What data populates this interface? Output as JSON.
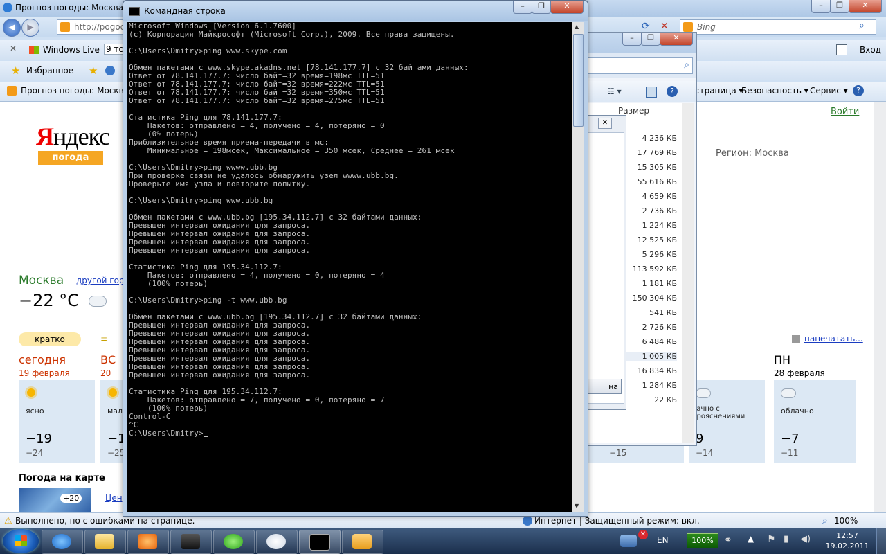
{
  "ie": {
    "title": "Прогноз погоды: Москва (Р",
    "address": "http://pogod",
    "search_placeholder": "Bing",
    "toolbar_items": [
      "Windows Live",
      "9 точ"
    ],
    "login": "Вход",
    "favorites": "Избранное",
    "tab_title": "Прогноз погоды: Москва (Р",
    "command_bar": [
      "страница ▾",
      "Безопасность ▾",
      "Сервис ▾"
    ],
    "status_text": "Выполнено, но с ошибками на странице.",
    "status_zone": "Интернет | Защищенный режим: вкл.",
    "zoom": "100%"
  },
  "yandex": {
    "logo_first": "Я",
    "logo_rest": "ндекс",
    "pogoda": "погода",
    "login_link": "Войти",
    "region_label": "Регион",
    "region_value": ": Москва",
    "city": "Москва",
    "other_city": "другой гор",
    "temp": "−22 °С",
    "short_btn": "кратко",
    "print_link": "напечатать...",
    "map_title": "Погода на карте",
    "map_temp": "+20",
    "map_link": "Цен",
    "days": [
      {
        "name": "сегодня",
        "date": "19 февраля",
        "cond": "ясно",
        "hi": "−19",
        "lo": "−24",
        "icon": "sun-icon"
      },
      {
        "name": "ВС",
        "date": "20",
        "cond": "мал",
        "hi": "−1",
        "lo": "−25",
        "icon": "sun-cloud-icon"
      },
      {
        "name": "",
        "date": "",
        "cond": "",
        "hi": "",
        "lo": "−15",
        "icon": ""
      },
      {
        "name": "",
        "date": "",
        "cond": "лачно с\nпрояснениями",
        "hi": "9",
        "lo": "−14",
        "icon": "cloud-icon"
      },
      {
        "name": "ПН",
        "date": "28 февраля",
        "cond": "облачно",
        "hi": "−7",
        "lo": "−11",
        "icon": "cloud-icon"
      }
    ]
  },
  "explorer": {
    "column": "Размер",
    "sizes": [
      "4 236 КБ",
      "17 769 КБ",
      "15 305 КБ",
      "55 616 КБ",
      "4 659 КБ",
      "2 736 КБ",
      "1 224 КБ",
      "12 525 КБ",
      "5 296 КБ",
      "113 592 КБ",
      "1 181 КБ",
      "150 304 КБ",
      "541 КБ",
      "2 726 КБ",
      "6 484 КБ",
      "1 005 КБ",
      "16 834 КБ",
      "1 284 КБ",
      "22 КБ"
    ],
    "dialog_btn": "на"
  },
  "cmd": {
    "title": "Командная строка",
    "output": "Microsoft Windows [Version 6.1.7600]\n(c) Корпорация Майкрософт (Microsoft Corp.), 2009. Все права защищены.\n\nC:\\Users\\Dmitry>ping www.skype.com\n\nОбмен пакетами с www.skype.akadns.net [78.141.177.7] с 32 байтами данных:\nОтвет от 78.141.177.7: число байт=32 время=198мс TTL=51\nОтвет от 78.141.177.7: число байт=32 время=222мс TTL=51\nОтвет от 78.141.177.7: число байт=32 время=350мс TTL=51\nОтвет от 78.141.177.7: число байт=32 время=275мс TTL=51\n\nСтатистика Ping для 78.141.177.7:\n    Пакетов: отправлено = 4, получено = 4, потеряно = 0\n    (0% потерь)\nПриблизительное время приема-передачи в мс:\n    Минимальное = 198мсек, Максимальное = 350 мсек, Среднее = 261 мсек\n\nC:\\Users\\Dmitry>ping wwww.ubb.bg\nПри проверке связи не удалось обнаружить узел wwww.ubb.bg.\nПроверьте имя узла и повторите попытку.\n\nC:\\Users\\Dmitry>ping www.ubb.bg\n\nОбмен пакетами с www.ubb.bg [195.34.112.7] с 32 байтами данных:\nПревышен интервал ожидания для запроса.\nПревышен интервал ожидания для запроса.\nПревышен интервал ожидания для запроса.\nПревышен интервал ожидания для запроса.\n\nСтатистика Ping для 195.34.112.7:\n    Пакетов: отправлено = 4, получено = 0, потеряно = 4\n    (100% потерь)\n\nC:\\Users\\Dmitry>ping -t www.ubb.bg\n\nОбмен пакетами с www.ubb.bg [195.34.112.7] с 32 байтами данных:\nПревышен интервал ожидания для запроса.\nПревышен интервал ожидания для запроса.\nПревышен интервал ожидания для запроса.\nПревышен интервал ожидания для запроса.\nПревышен интервал ожидания для запроса.\nПревышен интервал ожидания для запроса.\nПревышен интервал ожидания для запроса.\n\nСтатистика Ping для 195.34.112.7:\n    Пакетов: отправлено = 7, получено = 0, потеряно = 7\n    (100% потерь)\nControl-C\n^C\nC:\\Users\\Dmitry>"
  },
  "taskbar": {
    "lang": "EN",
    "battery": "100%",
    "time": "12:57",
    "date": "19.02.2011",
    "apps": [
      "ie-icon",
      "explorer-icon",
      "media-player-icon",
      "laptop-icon",
      "icq-icon",
      "compass-icon",
      "cmd-icon",
      "paint-icon"
    ]
  },
  "colors": {
    "console_bg": "#000000",
    "console_fg": "#c0c0c0",
    "yandex_red": "#ee0000",
    "pogoda_orange": "#f5a623",
    "today_red": "#cc3300",
    "city_green": "#2a7a2a"
  }
}
